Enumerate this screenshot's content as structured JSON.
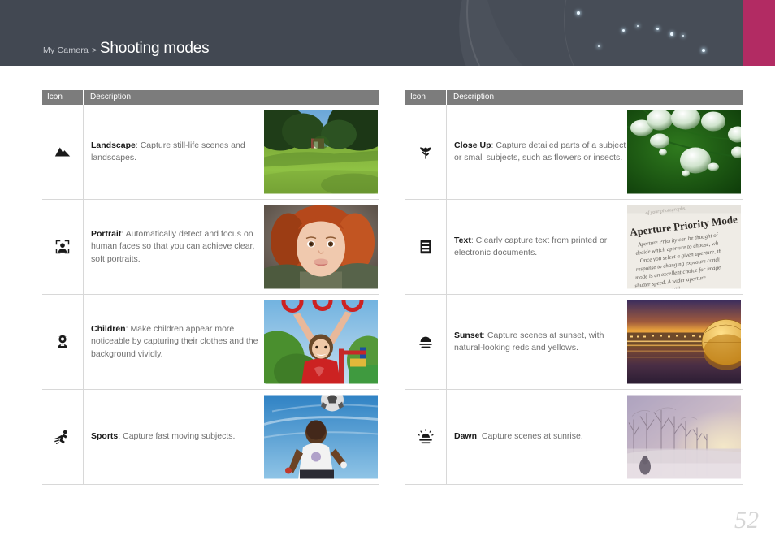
{
  "header": {
    "breadcrumb_parent": "My Camera",
    "breadcrumb_separator": ">",
    "title": "Shooting modes",
    "background_color": "#424852",
    "accent_color": "#b22b63"
  },
  "tables": {
    "columns": [
      "Icon",
      "Description"
    ],
    "header_background": "#7c7c7c",
    "left": {
      "header_icon": "Icon",
      "header_description": "Description",
      "rows": [
        {
          "icon_name": "landscape-mountain-icon",
          "mode": "Landscape",
          "separator": ": ",
          "description": "Capture still-life scenes and landscapes.",
          "photo_name": "landscape-park-photo",
          "photo_alt": "Sunlit green lawn with trees and a small building under blue sky"
        },
        {
          "icon_name": "portrait-face-frame-icon",
          "mode": "Portrait",
          "separator": ": ",
          "description": "Automatically detect and focus on human faces so that you can achieve clear, soft portraits.",
          "photo_name": "portrait-child-photo",
          "photo_alt": "Close-up portrait of a red-haired child smiling"
        },
        {
          "icon_name": "children-child-icon",
          "mode": "Children",
          "separator": ": ",
          "description": "Make children appear more noticeable by capturing their clothes and the background vividly.",
          "photo_name": "children-playground-photo",
          "photo_alt": "Girl in red shirt hanging from playground rings"
        },
        {
          "icon_name": "sports-runner-icon",
          "mode": "Sports",
          "separator": ": ",
          "description": "Capture fast moving subjects.",
          "photo_name": "sports-soccer-photo",
          "photo_alt": "Man heading a soccer ball against a blue sky"
        }
      ]
    },
    "right": {
      "header_icon": "Icon",
      "header_description": "Description",
      "rows": [
        {
          "icon_name": "close-up-flower-icon",
          "mode": "Close Up",
          "separator": ": ",
          "description": "Capture detailed parts of a subject or small subjects, such as flowers or insects.",
          "photo_name": "closeup-waterdrops-photo",
          "photo_alt": "Water droplets on a green leaf"
        },
        {
          "icon_name": "text-document-icon",
          "mode": "Text",
          "separator": ": ",
          "description": "Clearly capture text from printed or electronic documents.",
          "photo_name": "text-book-page-photo",
          "photo_alt": "Book page headed Aperture Priority Mode",
          "photo_text": "Aperture Priority Mode"
        },
        {
          "icon_name": "sunset-icon",
          "mode": "Sunset",
          "separator": ": ",
          "description": "Capture scenes at sunset, with natural-looking reds and yellows.",
          "photo_name": "sunset-building-photo",
          "photo_alt": "Golden domed building reflected in water at dusk"
        },
        {
          "icon_name": "dawn-sunrise-icon",
          "mode": "Dawn",
          "separator": ": ",
          "description": "Capture scenes at sunrise.",
          "photo_name": "dawn-misty-road-photo",
          "photo_alt": "Misty snowy tree-lined road at sunrise"
        }
      ]
    }
  },
  "footer": {
    "page_number": "52"
  }
}
